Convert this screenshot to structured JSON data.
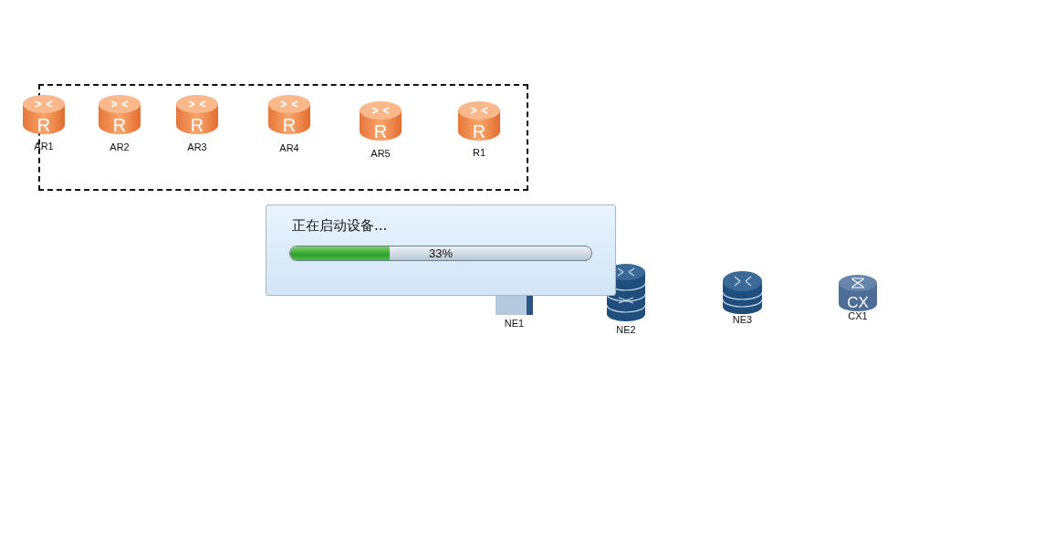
{
  "canvas": {
    "nodes": [
      {
        "kind": "router",
        "name": "AR1",
        "badge": "R"
      },
      {
        "kind": "router",
        "name": "AR2",
        "badge": "R"
      },
      {
        "kind": "router",
        "name": "AR3",
        "badge": "R"
      },
      {
        "kind": "router",
        "name": "AR4",
        "badge": "R"
      },
      {
        "kind": "router",
        "name": "AR5",
        "badge": "R"
      },
      {
        "kind": "router",
        "name": "R1",
        "badge": "R"
      },
      {
        "kind": "switch",
        "name": "NE1"
      },
      {
        "kind": "ne-router",
        "name": "NE2"
      },
      {
        "kind": "ne-stack",
        "name": "NE3"
      },
      {
        "kind": "cx",
        "name": "CX1",
        "badge": "CX"
      }
    ]
  },
  "dialog": {
    "message": "正在启动设备...",
    "progress": {
      "level": 0.33,
      "reading": "33%"
    }
  }
}
